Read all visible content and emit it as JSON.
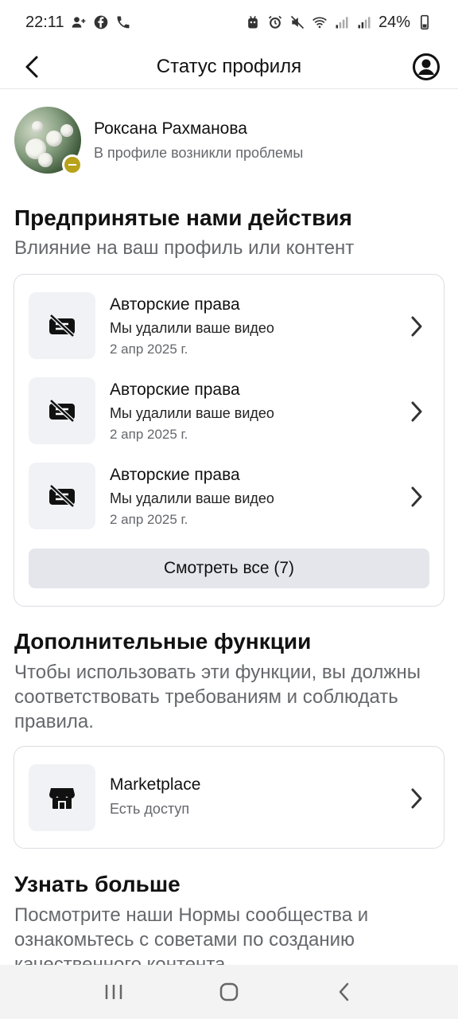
{
  "status_bar": {
    "time": "22:11",
    "battery": "24%"
  },
  "header": {
    "title": "Статус профиля"
  },
  "profile": {
    "name": "Роксана Рахманова",
    "status": "В профиле возникли проблемы"
  },
  "actions_section": {
    "title": "Предпринятые нами действия",
    "subtitle": "Влияние на ваш профиль или контент",
    "items": [
      {
        "title": "Авторские права",
        "description": "Мы удалили ваше видео",
        "date": "2 апр 2025 г."
      },
      {
        "title": "Авторские права",
        "description": "Мы удалили ваше видео",
        "date": "2 апр 2025 г."
      },
      {
        "title": "Авторские права",
        "description": "Мы удалили ваше видео",
        "date": "2 апр 2025 г."
      }
    ],
    "see_all_label": "Смотреть все (7)"
  },
  "features_section": {
    "title": "Дополнительные функции",
    "description": "Чтобы использовать эти функции, вы должны соответствовать требованиям и соблюдать правила.",
    "items": [
      {
        "title": "Marketplace",
        "status": "Есть доступ"
      }
    ]
  },
  "learn_section": {
    "title": "Узнать больше",
    "description": "Посмотрите наши Нормы сообщества и ознакомьтесь с советами по созданию качественного контента."
  },
  "colors": {
    "secondary_text": "#65676b",
    "tile_bg": "#f0f2f5",
    "button_bg": "#e4e6eb",
    "warning_badge": "#b8a21a"
  }
}
